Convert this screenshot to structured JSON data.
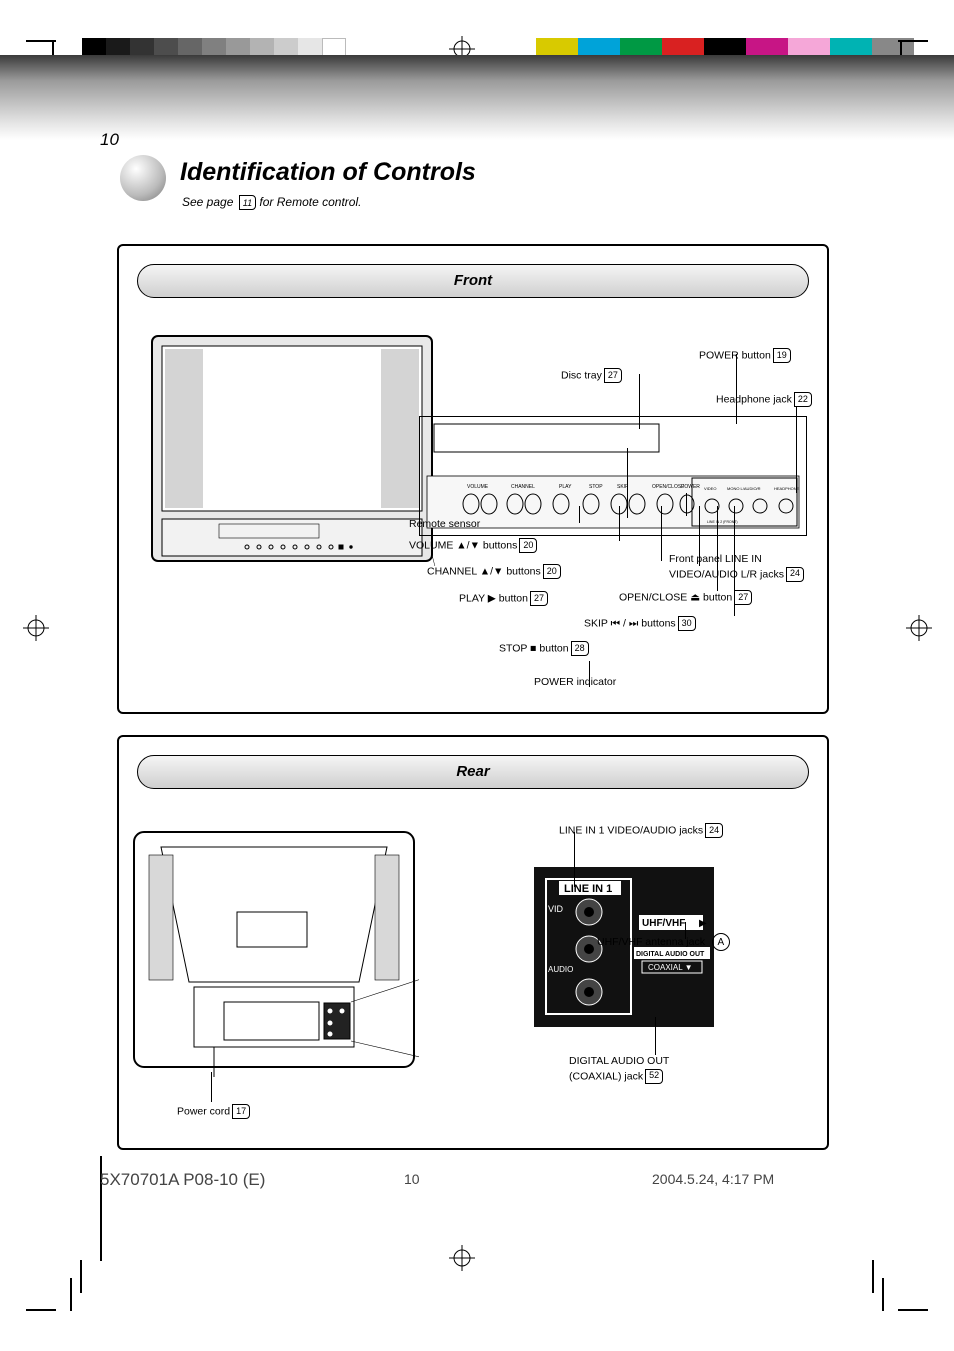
{
  "page_number": "10",
  "footer_label": "5X70701A P08-10 (E)",
  "title": "Identification of Controls",
  "subtitle_prefix": "See page",
  "subtitle_ref": "11",
  "subtitle_suffix": "for Remote control.",
  "front": {
    "title": "Front",
    "labels": {
      "remote_sensor": "Remote sensor",
      "power_indicator": "POWER indicator",
      "disc_tray": "Disc tray",
      "power": "POWER button",
      "headphone": "Headphone jack",
      "front_panel_linein": "Front panel LINE IN\\nVIDEO/AUDIO L/R jacks",
      "volume": "VOLUME ▲/▼ buttons",
      "channel": "CHANNEL ▲/▼ buttons",
      "play": "PLAY ▶ button",
      "stop": "STOP ■ button",
      "skip": "SKIP ⏮ / ⏭ buttons",
      "open_close": "OPEN/CLOSE ⏏ button"
    },
    "pages": {
      "disc_tray": "27",
      "power": "19",
      "headphone": "22",
      "front_panel_linein": "24",
      "volume": "20",
      "channel": "20",
      "play": "27",
      "stop": "28",
      "skip": "30",
      "open_close": "27"
    }
  },
  "rear": {
    "title": "Rear",
    "labels": {
      "line_in": "LINE IN 1 VIDEO/AUDIO jacks",
      "antenna": "UHF/VHF antenna jack",
      "power_cord": "Power cord",
      "coax": "DIGITAL AUDIO OUT\\n(COAXIAL) jack"
    },
    "pages": {
      "line_in": "24",
      "power_cord": "17",
      "coax": "52"
    },
    "antenna_ref": "A",
    "panel_text": {
      "line_in_box": "LINE IN 1",
      "vid": "VID",
      "audio": "AUDIO",
      "uhf": "UHF/VHF",
      "digital": "DIGITAL AUDIO OUT",
      "coax": "COAXIAL ▼"
    }
  },
  "date_stamp": "2004.5.24, 4:17 PM"
}
